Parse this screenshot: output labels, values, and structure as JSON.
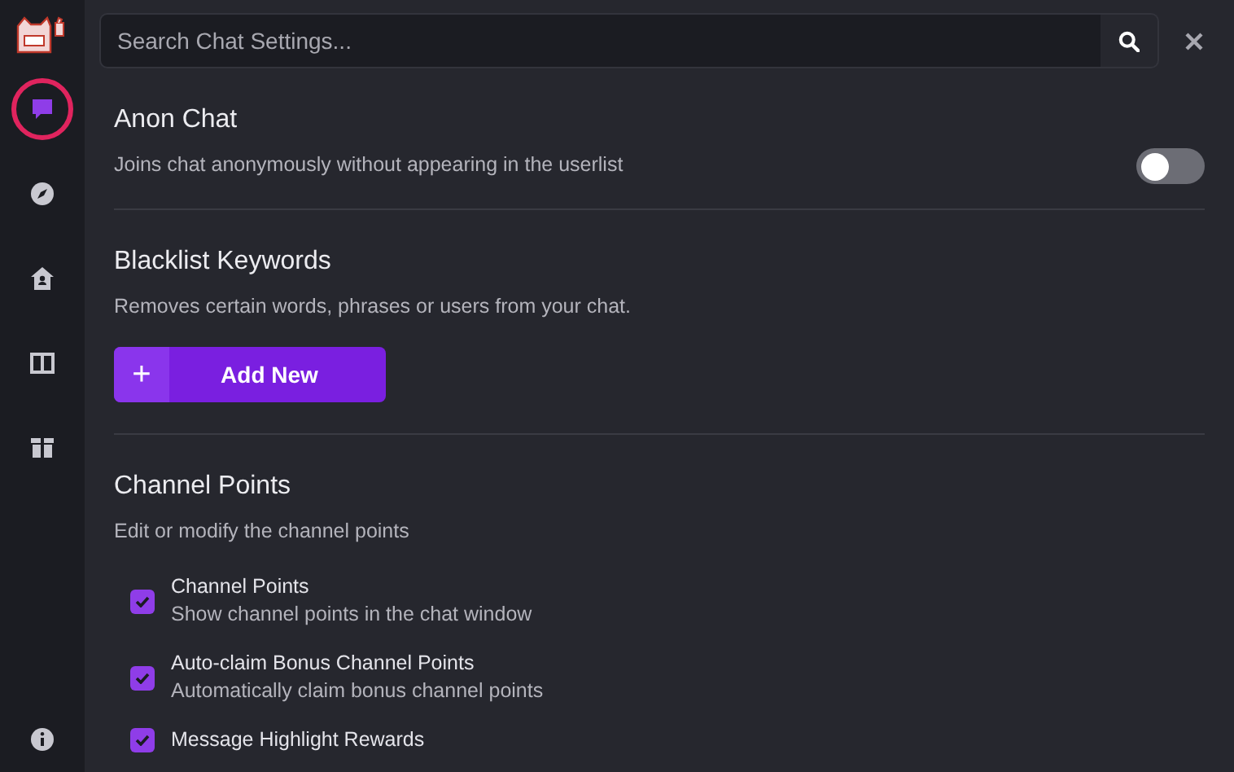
{
  "sidebar": {
    "items": [
      {
        "kind": "chat",
        "selected": true
      },
      {
        "kind": "compass",
        "selected": false
      },
      {
        "kind": "home",
        "selected": false
      },
      {
        "kind": "columns",
        "selected": false
      },
      {
        "kind": "box",
        "selected": false
      }
    ]
  },
  "search": {
    "placeholder": "Search Chat Settings..."
  },
  "sections": [
    {
      "kind": "toggle",
      "title": "Anon Chat",
      "description": "Joins chat anonymously without appearing in the userlist",
      "on": false
    },
    {
      "kind": "button",
      "title": "Blacklist Keywords",
      "description": "Removes certain words, phrases or users from your chat.",
      "button_icon": "+",
      "button_label": "Add New"
    },
    {
      "kind": "checklist",
      "title": "Channel Points",
      "description": "Edit or modify the channel points",
      "items": [
        {
          "label": "Channel Points",
          "description": "Show channel points in the chat window",
          "checked": true
        },
        {
          "label": "Auto-claim Bonus Channel Points",
          "description": "Automatically claim bonus channel points",
          "checked": true
        },
        {
          "label": "Message Highlight Rewards",
          "checked": true
        }
      ]
    }
  ]
}
